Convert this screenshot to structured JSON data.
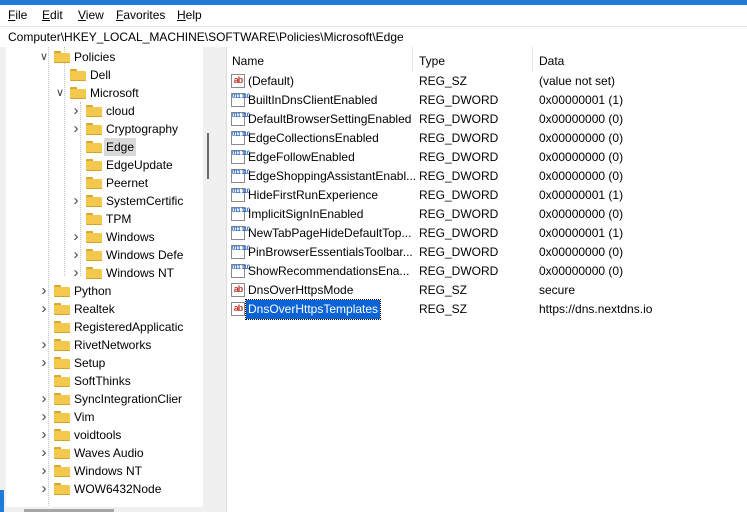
{
  "menu": [
    {
      "key": "file",
      "first": "F",
      "rest": "ile"
    },
    {
      "key": "edit",
      "first": "E",
      "rest": "dit"
    },
    {
      "key": "view",
      "first": "V",
      "rest": "iew"
    },
    {
      "key": "favorites",
      "first": "F",
      "rest": "avorites",
      "pre": "",
      "alt": true
    },
    {
      "key": "help",
      "first": "H",
      "rest": "elp"
    }
  ],
  "address": "Computer\\HKEY_LOCAL_MACHINE\\SOFTWARE\\Policies\\Microsoft\\Edge",
  "tree": [
    {
      "label": "Policies",
      "level": 0,
      "expander": "expanded",
      "selected": false
    },
    {
      "label": "Dell",
      "level": 1,
      "expander": "none",
      "selected": false
    },
    {
      "label": "Microsoft",
      "level": 1,
      "expander": "expanded",
      "selected": false
    },
    {
      "label": "cloud",
      "level": 2,
      "expander": "collapsed",
      "selected": false
    },
    {
      "label": "Cryptography",
      "level": 2,
      "expander": "collapsed",
      "selected": false
    },
    {
      "label": "Edge",
      "level": 2,
      "expander": "none",
      "selected": true
    },
    {
      "label": "EdgeUpdate",
      "level": 2,
      "expander": "none",
      "selected": false
    },
    {
      "label": "Peernet",
      "level": 2,
      "expander": "none",
      "selected": false
    },
    {
      "label": "SystemCertific",
      "level": 2,
      "expander": "collapsed",
      "selected": false
    },
    {
      "label": "TPM",
      "level": 2,
      "expander": "none",
      "selected": false
    },
    {
      "label": "Windows",
      "level": 2,
      "expander": "collapsed",
      "selected": false
    },
    {
      "label": "Windows Defe",
      "level": 2,
      "expander": "collapsed",
      "selected": false
    },
    {
      "label": "Windows NT",
      "level": 2,
      "expander": "collapsed",
      "selected": false
    },
    {
      "label": "Python",
      "level": 0,
      "expander": "collapsed",
      "selected": false
    },
    {
      "label": "Realtek",
      "level": 0,
      "expander": "collapsed",
      "selected": false
    },
    {
      "label": "RegisteredApplicatic",
      "level": 0,
      "expander": "none",
      "selected": false
    },
    {
      "label": "RivetNetworks",
      "level": 0,
      "expander": "collapsed",
      "selected": false
    },
    {
      "label": "Setup",
      "level": 0,
      "expander": "collapsed",
      "selected": false
    },
    {
      "label": "SoftThinks",
      "level": 0,
      "expander": "none",
      "selected": false
    },
    {
      "label": "SyncIntegrationClier",
      "level": 0,
      "expander": "collapsed",
      "selected": false
    },
    {
      "label": "Vim",
      "level": 0,
      "expander": "collapsed",
      "selected": false
    },
    {
      "label": "voidtools",
      "level": 0,
      "expander": "collapsed",
      "selected": false
    },
    {
      "label": "Waves Audio",
      "level": 0,
      "expander": "collapsed",
      "selected": false
    },
    {
      "label": "Windows NT",
      "level": 0,
      "expander": "collapsed",
      "selected": false
    },
    {
      "label": "WOW6432Node",
      "level": 0,
      "expander": "collapsed",
      "selected": false
    }
  ],
  "columns": {
    "name": "Name",
    "type": "Type",
    "data": "Data"
  },
  "values": [
    {
      "name": "(Default)",
      "type": "REG_SZ",
      "data": "(value not set)",
      "icon": "string"
    },
    {
      "name": "BuiltInDnsClientEnabled",
      "type": "REG_DWORD",
      "data": "0x00000001 (1)",
      "icon": "dword"
    },
    {
      "name": "DefaultBrowserSettingEnabled",
      "type": "REG_DWORD",
      "data": "0x00000000 (0)",
      "icon": "dword"
    },
    {
      "name": "EdgeCollectionsEnabled",
      "type": "REG_DWORD",
      "data": "0x00000000 (0)",
      "icon": "dword"
    },
    {
      "name": "EdgeFollowEnabled",
      "type": "REG_DWORD",
      "data": "0x00000000 (0)",
      "icon": "dword"
    },
    {
      "name": "EdgeShoppingAssistantEnabl...",
      "type": "REG_DWORD",
      "data": "0x00000000 (0)",
      "icon": "dword"
    },
    {
      "name": "HideFirstRunExperience",
      "type": "REG_DWORD",
      "data": "0x00000001 (1)",
      "icon": "dword"
    },
    {
      "name": "ImplicitSignInEnabled",
      "type": "REG_DWORD",
      "data": "0x00000000 (0)",
      "icon": "dword"
    },
    {
      "name": "NewTabPageHideDefaultTop...",
      "type": "REG_DWORD",
      "data": "0x00000001 (1)",
      "icon": "dword"
    },
    {
      "name": "PinBrowserEssentialsToolbar...",
      "type": "REG_DWORD",
      "data": "0x00000000 (0)",
      "icon": "dword"
    },
    {
      "name": "ShowRecommendationsEna...",
      "type": "REG_DWORD",
      "data": "0x00000000 (0)",
      "icon": "dword"
    },
    {
      "name": "DnsOverHttpsMode",
      "type": "REG_SZ",
      "data": "secure",
      "icon": "string"
    },
    {
      "name": "DnsOverHttpsTemplates",
      "type": "REG_SZ",
      "data": "https://dns.nextdns.io",
      "icon": "string",
      "selected": true
    }
  ],
  "icons": {
    "string": "ab",
    "dword": "011 110"
  },
  "colors": {
    "accent": "#0a64d6",
    "folder": "#f2c94c",
    "selection_tree": "#d9d9d9"
  }
}
